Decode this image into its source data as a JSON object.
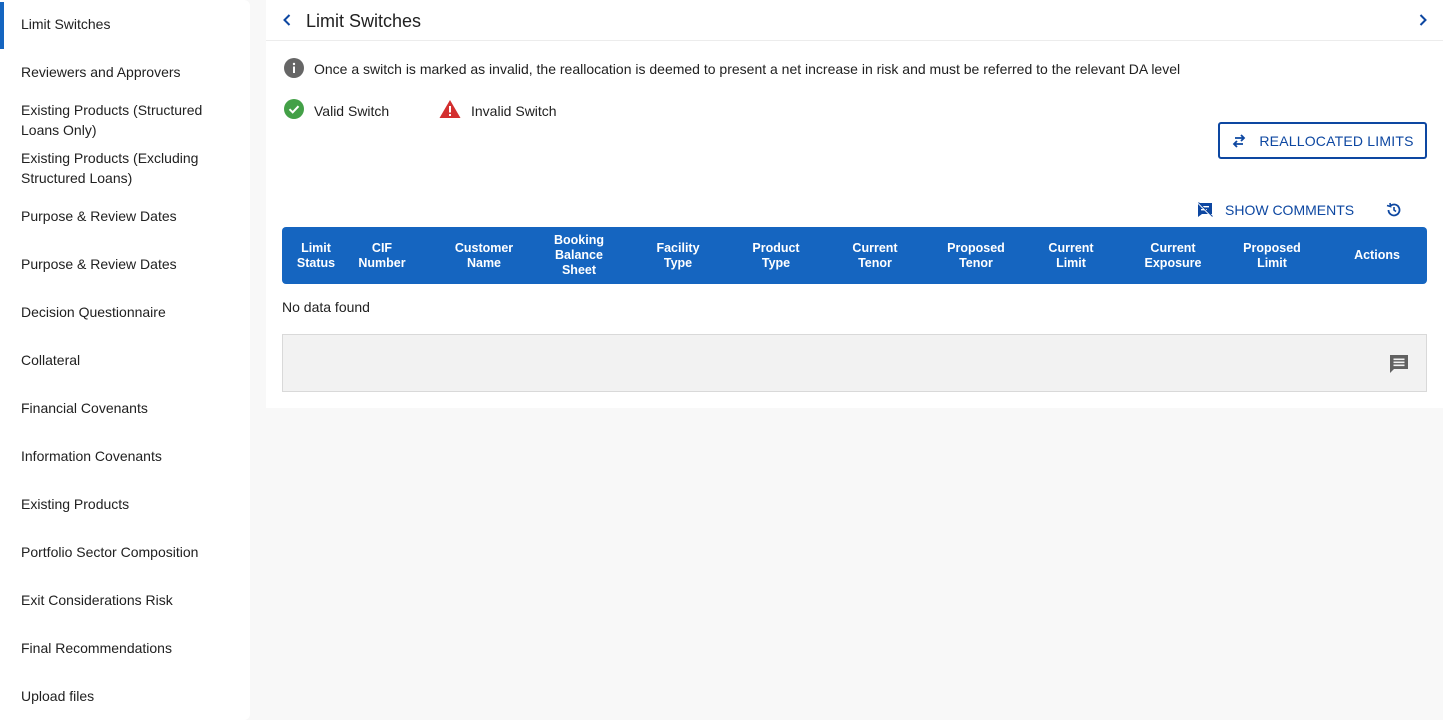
{
  "sidebar": {
    "items": [
      {
        "label": "Limit Switches"
      },
      {
        "label": "Reviewers and Approvers"
      },
      {
        "label": "Existing Products (Structured Loans Only)"
      },
      {
        "label": "Existing Products (Excluding Structured Loans)"
      },
      {
        "label": "Purpose & Review Dates"
      },
      {
        "label": "Purpose & Review Dates"
      },
      {
        "label": "Decision Questionnaire"
      },
      {
        "label": "Collateral"
      },
      {
        "label": "Financial Covenants"
      },
      {
        "label": "Information Covenants"
      },
      {
        "label": "Existing Products"
      },
      {
        "label": "Portfolio Sector Composition"
      },
      {
        "label": "Exit Considerations Risk"
      },
      {
        "label": "Final Recommendations"
      },
      {
        "label": "Upload files"
      }
    ]
  },
  "header": {
    "title": "Limit Switches"
  },
  "info": {
    "text": "Once a switch is marked as invalid, the reallocation is deemed to present a net increase in risk and must be referred to the relevant DA level"
  },
  "legend": {
    "valid": "Valid Switch",
    "invalid": "Invalid Switch"
  },
  "buttons": {
    "reallocated": "REALLOCATED LIMITS",
    "show_comments": "SHOW COMMENTS"
  },
  "table": {
    "columns": [
      "Limit\nStatus",
      "CIF\nNumber",
      "Customer\nName",
      "Booking\nBalance\nSheet",
      "Facility\nType",
      "Product\nType",
      "Current\nTenor",
      "Proposed\nTenor",
      "Current\nLimit",
      "Current\nExposure",
      "Proposed\nLimit",
      "Actions"
    ],
    "empty_text": "No data found"
  },
  "colors": {
    "primary": "#1565c0",
    "primary_dark": "#0d47a1",
    "valid": "#43a047",
    "invalid": "#d32f2f"
  }
}
